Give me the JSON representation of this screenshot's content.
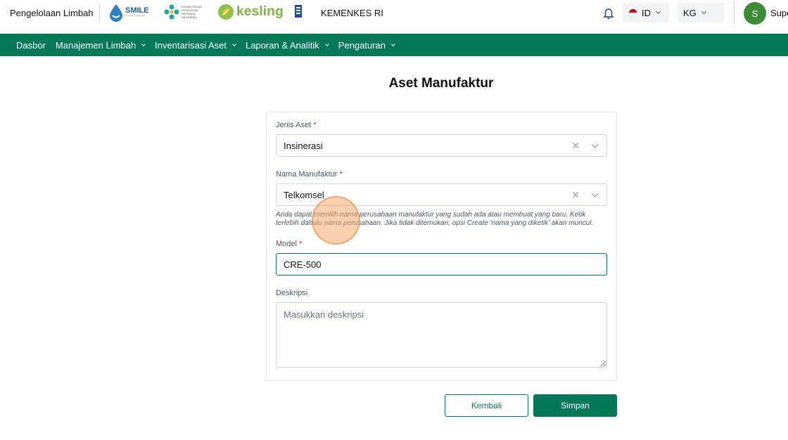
{
  "header": {
    "app_title": "Pengelolaan Limbah",
    "logos": {
      "smile": "SMILE",
      "kemenkes": "KEMENTERIAN KESEHATAN REPUBLIK INDONESIA",
      "kesling": "kesling"
    },
    "org_name": "KEMENKES RI",
    "language": "ID",
    "unit": "KG",
    "avatar_initial": "S",
    "user_name": "Supe"
  },
  "nav": {
    "items": [
      {
        "label": "Dasbor",
        "has_dropdown": false
      },
      {
        "label": "Manajemen Limbah",
        "has_dropdown": true
      },
      {
        "label": "Inventarisasi Aset",
        "has_dropdown": true
      },
      {
        "label": "Laporan & Analitik",
        "has_dropdown": true
      },
      {
        "label": "Pengaturan",
        "has_dropdown": true
      }
    ]
  },
  "page": {
    "title": "Aset Manufaktur"
  },
  "form": {
    "jenis_aset": {
      "label": "Jenis Aset",
      "required_mark": "*",
      "value": "Insinerasi"
    },
    "nama_manufaktur": {
      "label": "Nama Manufaktur",
      "required_mark": "*",
      "value": "Telkomsel",
      "hint_line1": "Anda dapat memilih nama perusahaan manufaktur yang sudah ada atau membuat yang baru. Ketik",
      "hint_line2": "terlebih dahulu nama perusahaan. Jika tidak ditemukan, opsi Create 'nama yang diketik' akan muncul."
    },
    "model": {
      "label": "Model",
      "required_mark": "*",
      "value": "CRE-500"
    },
    "deskripsi": {
      "label": "Deskripsi",
      "placeholder": "Masukkan deskripsi",
      "value": ""
    }
  },
  "actions": {
    "back_label": "Kembali",
    "save_label": "Simpan"
  },
  "colors": {
    "primary": "#04795a",
    "required": "#e11d48",
    "avatar": "#3d8b37"
  },
  "icons": {
    "notification": "bell-icon",
    "dropdown": "chevron-down-icon",
    "clear": "close-icon"
  }
}
